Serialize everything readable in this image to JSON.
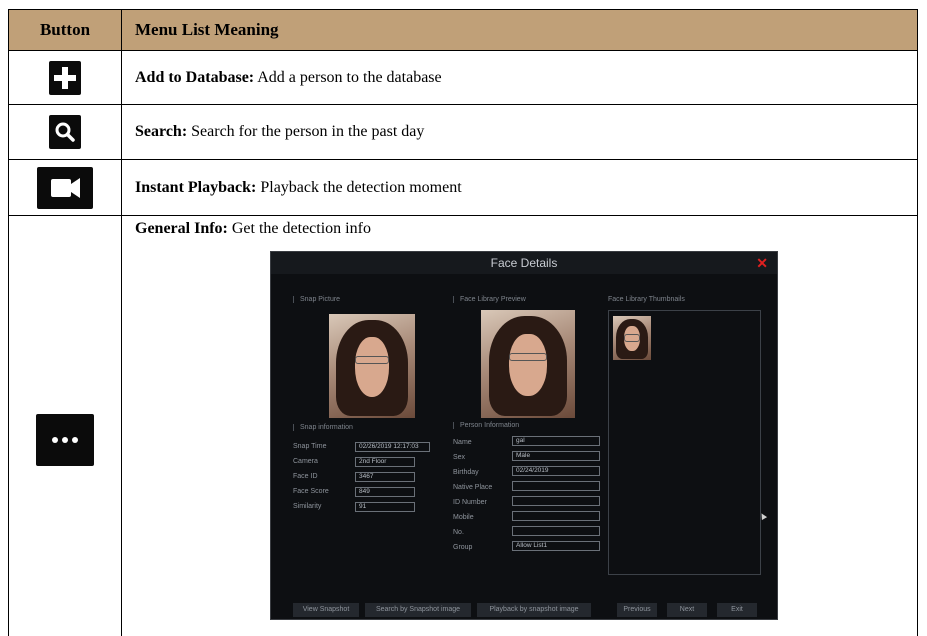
{
  "table": {
    "header": {
      "button_col": "Button",
      "meaning_col": "Menu List Meaning"
    },
    "rows": [
      {
        "icon": "plus-icon",
        "term": "Add to Database:",
        "text": " Add a person to the database"
      },
      {
        "icon": "search-icon",
        "term": "Search:",
        "text": " Search for the person in the past day"
      },
      {
        "icon": "video-camera-icon",
        "term": "Instant Playback:",
        "text": " Playback the detection moment"
      },
      {
        "icon": "more-dots-icon",
        "term": "General Info:",
        "text": " Get the detection info"
      }
    ]
  },
  "dialog": {
    "title": "Face Details",
    "close_icon": "close-icon",
    "close_color": "#e02020",
    "sections": {
      "snap_picture": "Snap Picture",
      "library_preview": "Face Library Preview",
      "library_thumbnails": "Face Library Thumbnails",
      "snap_info": "Snap information",
      "person_info": "Person Information"
    },
    "snap_fields": [
      {
        "label": "Snap Time",
        "value": "02/26/2019 12:17:03"
      },
      {
        "label": "Camera",
        "value": "2nd Floor"
      },
      {
        "label": "Face ID",
        "value": "3467"
      },
      {
        "label": "Face Score",
        "value": "849"
      },
      {
        "label": "Similarity",
        "value": "91"
      }
    ],
    "person_fields": [
      {
        "label": "Name",
        "value": "gal"
      },
      {
        "label": "Sex",
        "value": "Male"
      },
      {
        "label": "Birthday",
        "value": "02/24/2019"
      },
      {
        "label": "Native Place",
        "value": ""
      },
      {
        "label": "ID Number",
        "value": ""
      },
      {
        "label": "Mobile",
        "value": ""
      },
      {
        "label": "No.",
        "value": ""
      },
      {
        "label": "Group",
        "value": "Allow List1"
      }
    ],
    "buttons": {
      "view_snapshot": "View Snapshot",
      "search_by_snapshot": "Search by Snapshot image",
      "playback_by_snapshot": "Playback by snapshot image",
      "previous": "Previous",
      "next": "Next",
      "exit": "Exit"
    }
  },
  "colors": {
    "header_bg": "#c0a078",
    "icon_bg": "#0b0b0b",
    "dialog_bg": "#0d0f12"
  }
}
